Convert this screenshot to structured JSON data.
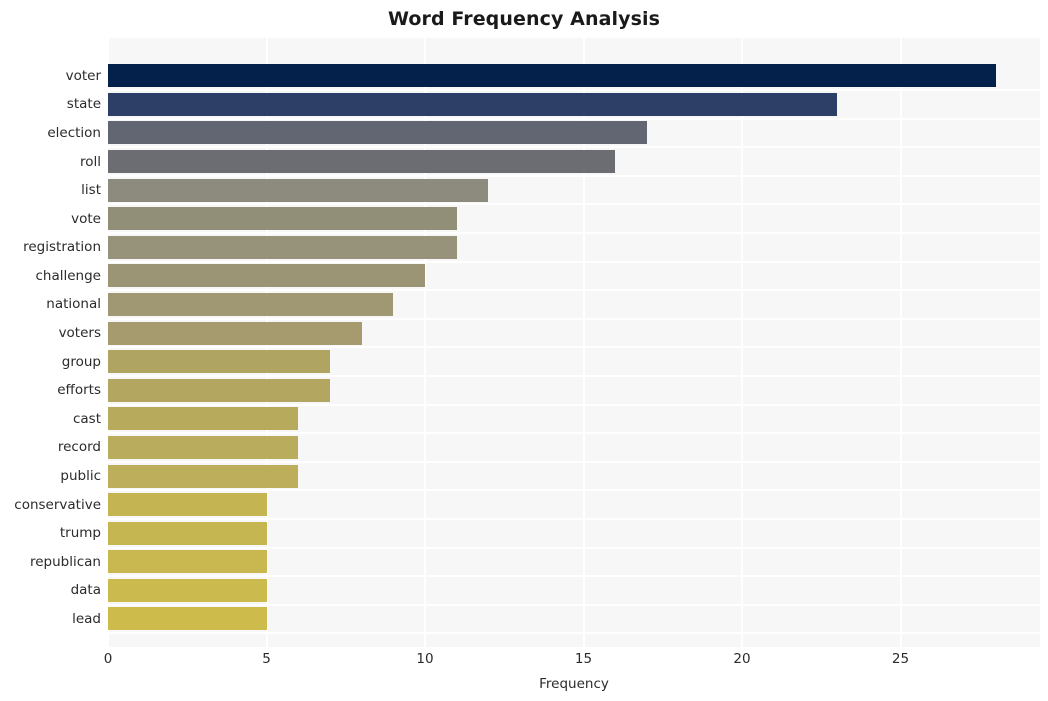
{
  "chart_data": {
    "type": "bar",
    "orientation": "horizontal",
    "title": "Word Frequency Analysis",
    "xlabel": "Frequency",
    "ylabel": "",
    "xlim": [
      0,
      29.4
    ],
    "xticks": [
      0,
      5,
      10,
      15,
      20,
      25
    ],
    "xticklabels": [
      "0",
      "5",
      "10",
      "15",
      "20",
      "25"
    ],
    "grid": true,
    "legend": false,
    "background": "#f7f7f7",
    "gridline_color": "#ffffff",
    "categories": [
      "voter",
      "state",
      "election",
      "roll",
      "list",
      "vote",
      "registration",
      "challenge",
      "national",
      "voters",
      "group",
      "efforts",
      "cast",
      "record",
      "public",
      "conservative",
      "trump",
      "republican",
      "data",
      "lead"
    ],
    "values": [
      28,
      23,
      17,
      16,
      12,
      11,
      11,
      10,
      9,
      8,
      7,
      7,
      6,
      6,
      6,
      5,
      5,
      5,
      5,
      5
    ],
    "colors": [
      "#04214c",
      "#2e3f67",
      "#626673",
      "#6b6d72",
      "#8c8b7d",
      "#928f78",
      "#97927a",
      "#9b9575",
      "#a09872",
      "#a59b6f",
      "#b0a462",
      "#b2a660",
      "#b7aa5d",
      "#b9ac5c",
      "#bcae5a",
      "#c4b452",
      "#c6b651",
      "#c8b84f",
      "#cbba4d",
      "#cdbc4b"
    ]
  }
}
